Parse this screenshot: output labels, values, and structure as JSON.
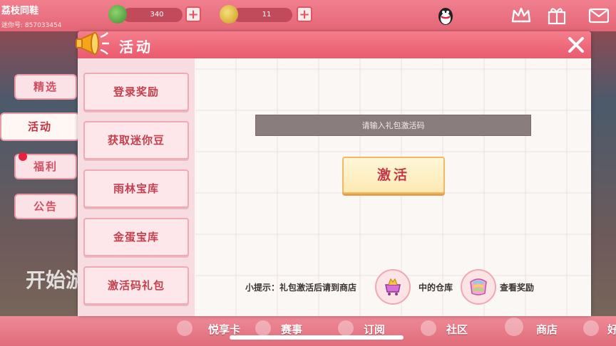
{
  "player": {
    "name": "荔枝同鞋",
    "id": "迷你号: 857033454"
  },
  "resources": [
    {
      "name": "mini-beans",
      "value": "340",
      "color": "#3f8c35"
    },
    {
      "name": "mini-coins",
      "value": "11",
      "color": "#d8a426"
    }
  ],
  "side_tabs": [
    {
      "label": "精选"
    },
    {
      "label": "活动"
    },
    {
      "label": "福利"
    },
    {
      "label": "公告"
    }
  ],
  "background": {
    "start_text": "开始游"
  },
  "bottom_nav": [
    {
      "label": "悦享卡"
    },
    {
      "label": "赛事"
    },
    {
      "label": "订阅"
    },
    {
      "label": "社区"
    },
    {
      "label": "商店"
    },
    {
      "label": "好"
    }
  ],
  "modal": {
    "title": "活动",
    "menu": [
      {
        "label": "登录奖励"
      },
      {
        "label": "获取迷你豆"
      },
      {
        "label": "雨林宝库"
      },
      {
        "label": "金蛋宝库"
      },
      {
        "label": "激活码礼包"
      }
    ],
    "code_placeholder": "请输入礼包激活码",
    "activate_label": "激活",
    "tip_part1": "小提示：礼包激活后请到商店",
    "tip_part2": "中的仓库",
    "tip_part3": "查看奖励"
  },
  "colors": {
    "accent": "#e95b6e",
    "header_pink": "#f07f8e",
    "button_gold": "#f3b861"
  }
}
